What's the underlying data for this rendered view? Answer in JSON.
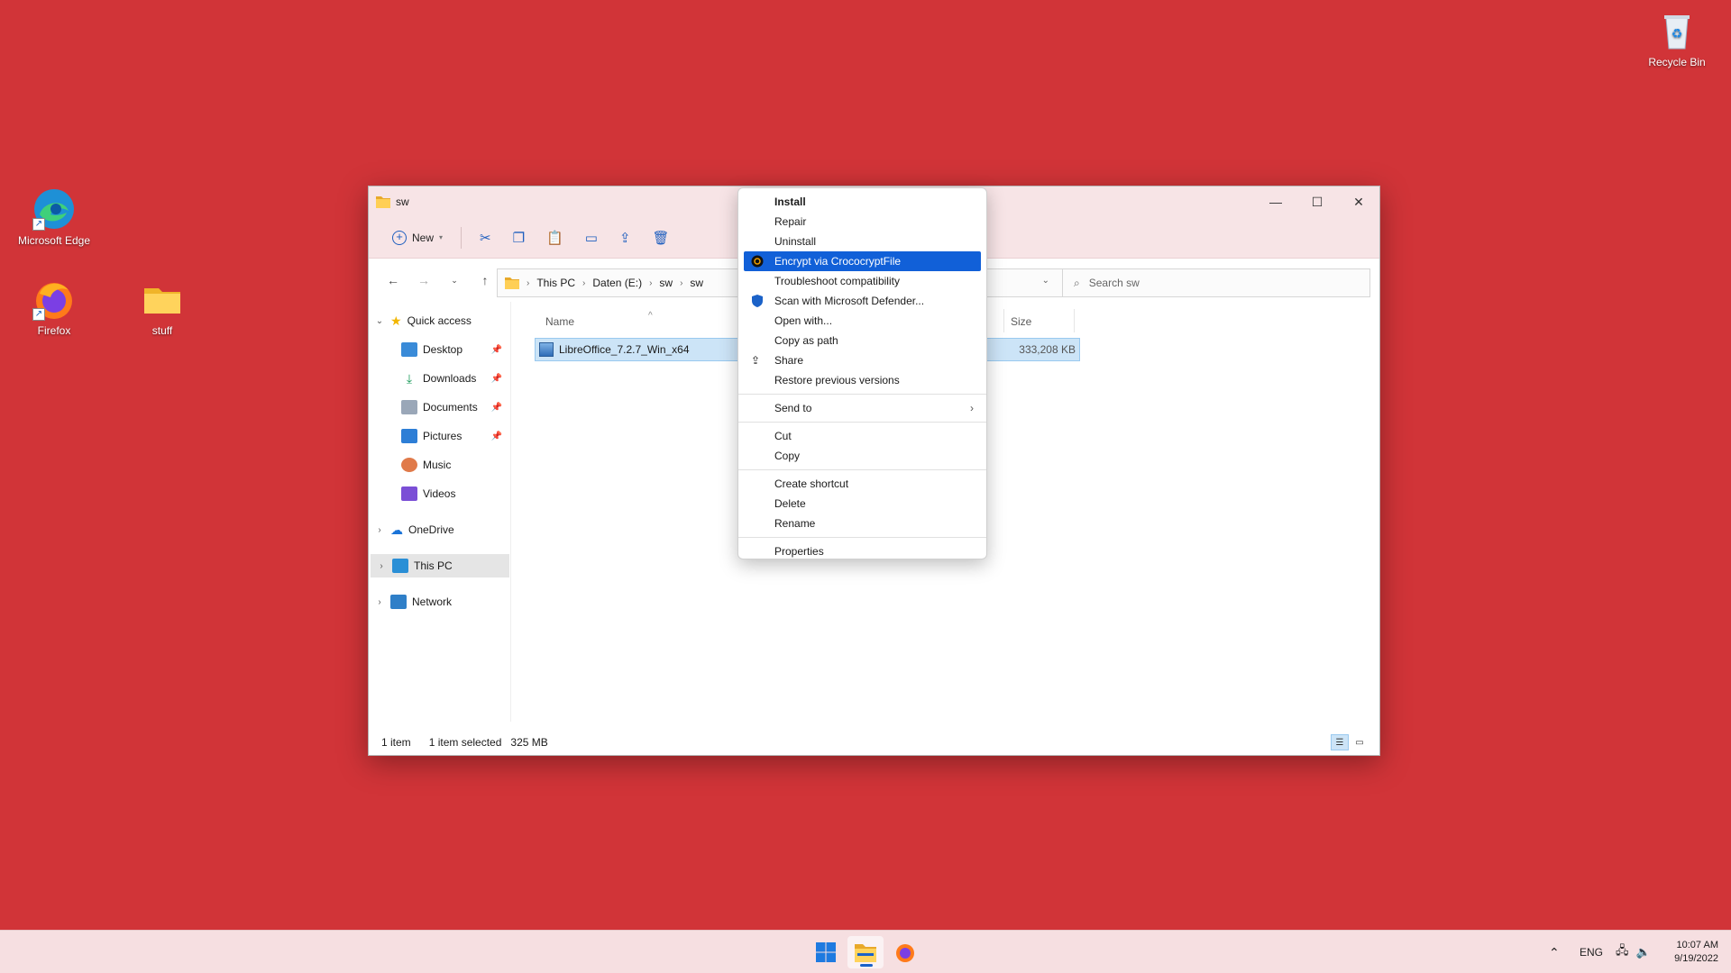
{
  "desktop": {
    "icons": [
      {
        "label": "Recycle Bin"
      },
      {
        "label": "Microsoft Edge"
      },
      {
        "label": "Firefox"
      },
      {
        "label": "stuff"
      }
    ]
  },
  "window": {
    "title": "sw",
    "toolbar": {
      "new_label": "New"
    },
    "breadcrumb": [
      "This PC",
      "Daten (E:)",
      "sw",
      "sw"
    ],
    "search_placeholder": "Search sw",
    "sidebar": {
      "quick_access": "Quick access",
      "items": [
        "Desktop",
        "Downloads",
        "Documents",
        "Pictures",
        "Music",
        "Videos"
      ],
      "onedrive": "OneDrive",
      "this_pc": "This PC",
      "network": "Network"
    },
    "columns": {
      "name": "Name",
      "size": "Size"
    },
    "files": [
      {
        "name": "LibreOffice_7.2.7_Win_x64",
        "size": "333,208 KB"
      }
    ],
    "status": {
      "count": "1 item",
      "selected": "1 item selected",
      "size": "325 MB"
    }
  },
  "context_menu": {
    "groups": [
      [
        "Install",
        "Repair",
        "Uninstall",
        "Encrypt via CrococryptFile",
        "Troubleshoot compatibility",
        "Scan with Microsoft Defender...",
        "Open with...",
        "Copy as path",
        "Share",
        "Restore previous versions"
      ],
      [
        "Send to"
      ],
      [
        "Cut",
        "Copy"
      ],
      [
        "Create shortcut",
        "Delete",
        "Rename"
      ],
      [
        "Properties"
      ]
    ]
  },
  "taskbar": {
    "language": "ENG",
    "time": "10:07 AM",
    "date": "9/19/2022"
  },
  "colors": {
    "desktop": "#d13438",
    "highlight": "#1160d8",
    "selection": "#cce4f7"
  }
}
